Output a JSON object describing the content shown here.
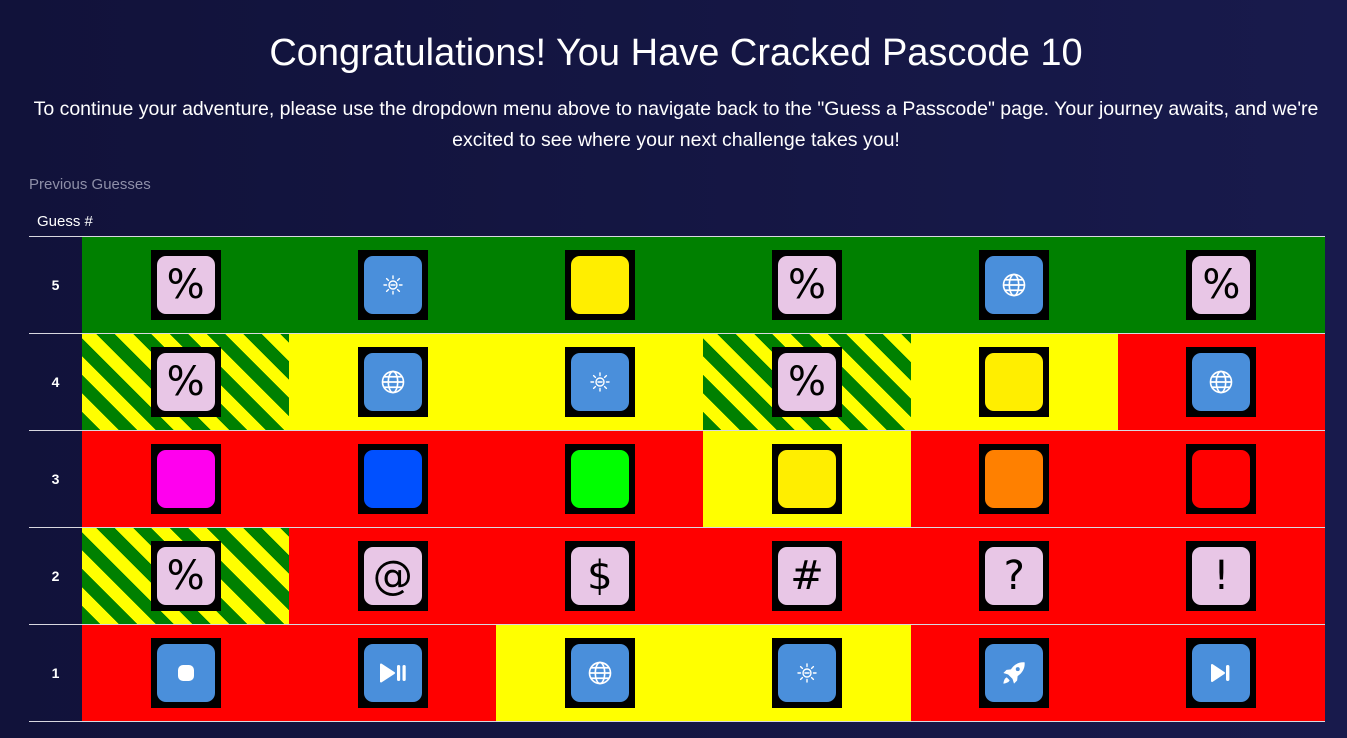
{
  "heading": {
    "title": "Congratulations! You Have Cracked Pascode 10",
    "message": "To continue your adventure, please use the dropdown menu above to navigate back to the \"Guess a Passcode\" page. Your journey awaits, and we're excited to see where your next challenge takes you!"
  },
  "table": {
    "caption": "Previous Guesses",
    "header_guess": "Guess #",
    "rows": [
      {
        "number": "5",
        "cells": [
          {
            "bg": "green",
            "tile": "symbol",
            "symbol": "%",
            "face_color": "#e8c6e6"
          },
          {
            "bg": "green",
            "tile": "icon",
            "icon": "brightness-icon",
            "face_color": "#4a8fdb"
          },
          {
            "bg": "green",
            "tile": "color",
            "face_color": "#ffee00"
          },
          {
            "bg": "green",
            "tile": "symbol",
            "symbol": "%",
            "face_color": "#e8c6e6"
          },
          {
            "bg": "green",
            "tile": "icon",
            "icon": "globe-icon",
            "face_color": "#4a8fdb"
          },
          {
            "bg": "green",
            "tile": "symbol",
            "symbol": "%",
            "face_color": "#e8c6e6"
          }
        ]
      },
      {
        "number": "4",
        "cells": [
          {
            "bg": "stripe",
            "tile": "symbol",
            "symbol": "%",
            "face_color": "#e8c6e6"
          },
          {
            "bg": "yellow",
            "tile": "icon",
            "icon": "globe-icon",
            "face_color": "#4a8fdb"
          },
          {
            "bg": "yellow",
            "tile": "icon",
            "icon": "brightness-icon",
            "face_color": "#4a8fdb"
          },
          {
            "bg": "stripe",
            "tile": "symbol",
            "symbol": "%",
            "face_color": "#e8c6e6"
          },
          {
            "bg": "yellow",
            "tile": "color",
            "face_color": "#ffee00"
          },
          {
            "bg": "red",
            "tile": "icon",
            "icon": "globe-icon",
            "face_color": "#4a8fdb"
          }
        ]
      },
      {
        "number": "3",
        "cells": [
          {
            "bg": "red",
            "tile": "color",
            "face_color": "#ff00ee"
          },
          {
            "bg": "red",
            "tile": "color",
            "face_color": "#0050ff"
          },
          {
            "bg": "red",
            "tile": "color",
            "face_color": "#00ff00"
          },
          {
            "bg": "yellow",
            "tile": "color",
            "face_color": "#ffee00"
          },
          {
            "bg": "red",
            "tile": "color",
            "face_color": "#ff8000"
          },
          {
            "bg": "red",
            "tile": "color",
            "face_color": "#ff0000"
          }
        ]
      },
      {
        "number": "2",
        "cells": [
          {
            "bg": "stripe",
            "tile": "symbol",
            "symbol": "%",
            "face_color": "#e8c6e6"
          },
          {
            "bg": "red",
            "tile": "symbol",
            "symbol": "@",
            "face_color": "#e8c6e6"
          },
          {
            "bg": "red",
            "tile": "symbol",
            "symbol": "$",
            "face_color": "#e8c6e6"
          },
          {
            "bg": "red",
            "tile": "symbol",
            "symbol": "#",
            "face_color": "#e8c6e6"
          },
          {
            "bg": "red",
            "tile": "symbol",
            "symbol": "?",
            "face_color": "#e8c6e6"
          },
          {
            "bg": "red",
            "tile": "symbol",
            "symbol": "!",
            "face_color": "#e8c6e6"
          }
        ]
      },
      {
        "number": "1",
        "cells": [
          {
            "bg": "red",
            "tile": "icon",
            "icon": "stop-icon",
            "face_color": "#4a8fdb"
          },
          {
            "bg": "red",
            "tile": "icon",
            "icon": "play-pause-icon",
            "face_color": "#4a8fdb"
          },
          {
            "bg": "yellow",
            "tile": "icon",
            "icon": "globe-icon",
            "face_color": "#4a8fdb"
          },
          {
            "bg": "yellow",
            "tile": "icon",
            "icon": "brightness-icon",
            "face_color": "#4a8fdb"
          },
          {
            "bg": "red",
            "tile": "icon",
            "icon": "rocket-icon",
            "face_color": "#4a8fdb"
          },
          {
            "bg": "red",
            "tile": "icon",
            "icon": "skip-next-icon",
            "face_color": "#4a8fdb"
          }
        ]
      }
    ]
  },
  "colors": {
    "page_bg_left": "#11123a",
    "page_bg_right": "#181a4c",
    "correct": "#008000",
    "present": "#ffff00",
    "absent": "#ff0000",
    "caption": "#8e8fa8"
  }
}
